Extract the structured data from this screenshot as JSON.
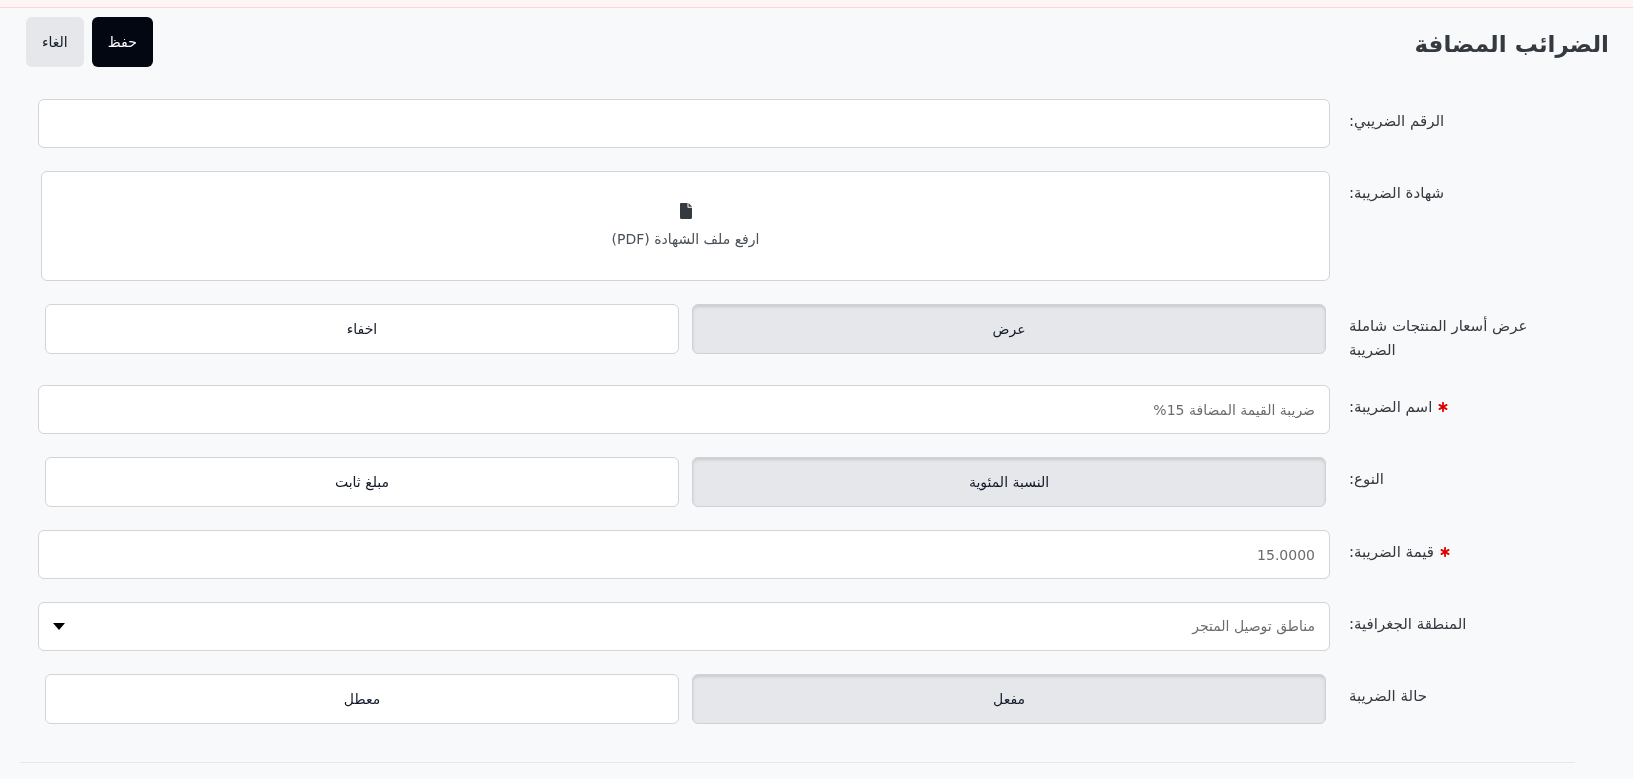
{
  "title": "الضرائب المضافة",
  "actions": [
    {
      "label": "حفظ",
      "kind": "primary"
    },
    {
      "label": "الغاء",
      "kind": "secondary"
    }
  ],
  "fields": [
    {
      "kind": "input",
      "label": "الرقم الضريبي:",
      "required": false
    },
    {
      "kind": "upload",
      "label": "شهادة الضريبة:",
      "required": false,
      "text": "ارفع ملف الشهادة (PDF)"
    },
    {
      "kind": "toggle",
      "label": "عرض أسعار المنتجات شاملة الضريبة",
      "required": false,
      "options": [
        {
          "label": "عرض",
          "selected": true
        },
        {
          "label": "اخفاء",
          "selected": false
        }
      ]
    },
    {
      "kind": "input",
      "label": "اسم الضريبة:",
      "required": true,
      "value": "ضريبة القيمة المضافة 15%"
    },
    {
      "kind": "toggle",
      "label": "النوع:",
      "required": false,
      "options": [
        {
          "label": "النسبة المئوية",
          "selected": true
        },
        {
          "label": "مبلغ ثابت",
          "selected": false
        }
      ]
    },
    {
      "kind": "input",
      "label": "قيمة الضريبة:",
      "required": true,
      "value": "15.0000"
    },
    {
      "kind": "select",
      "label": "المنطقة الجغرافية:",
      "required": false,
      "value": "مناطق توصيل المتجر"
    },
    {
      "kind": "toggle",
      "label": "حالة الضريبة",
      "required": false,
      "options": [
        {
          "label": "مفعل",
          "selected": true
        },
        {
          "label": "معطل",
          "selected": false
        }
      ]
    }
  ]
}
